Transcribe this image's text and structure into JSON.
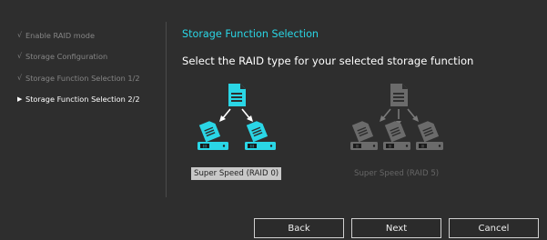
{
  "sidebar": {
    "steps": [
      {
        "mark": "√",
        "label": "Enable RAID mode"
      },
      {
        "mark": "√",
        "label": "Storage Configuration"
      },
      {
        "mark": "√",
        "label": "Storage Function Selection 1/2"
      },
      {
        "mark": "▶",
        "label": "Storage Function Selection 2/2"
      }
    ]
  },
  "main": {
    "heading": "Storage Function Selection",
    "prompt": "Select the RAID type for your selected storage function",
    "options": [
      {
        "label": "Super Speed (RAID 0)",
        "selected": true,
        "icon": "raid0-diagram-icon",
        "disk_label": "III"
      },
      {
        "label": "Super Speed (RAID 5)",
        "selected": false,
        "icon": "raid5-diagram-icon",
        "disk_label": "III"
      }
    ]
  },
  "buttons": {
    "back": "Back",
    "next": "Next",
    "cancel": "Cancel"
  },
  "colors": {
    "accent": "#2ad6e6",
    "selected_label_bg": "#c8c8c8",
    "disabled": "#6b6b6b"
  }
}
